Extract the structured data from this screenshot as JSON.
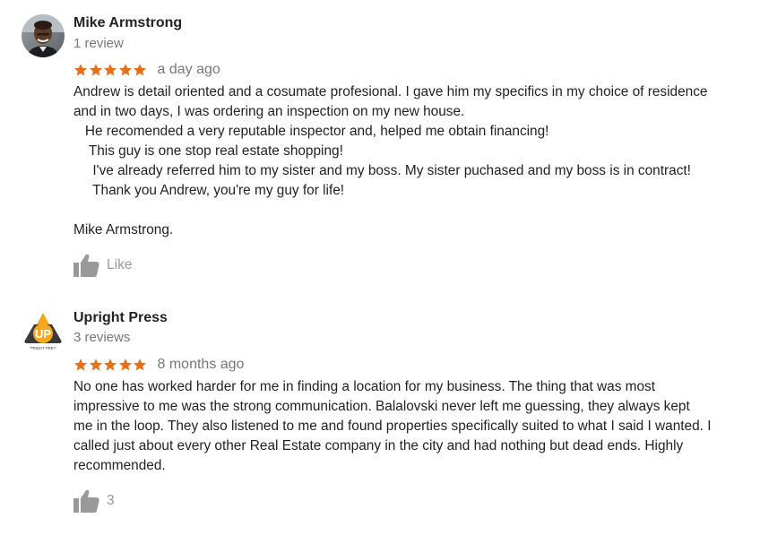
{
  "colors": {
    "star": "#e7711b",
    "name": "#222222",
    "muted": "#777777",
    "like": "#999999",
    "logo_gold": "#f3a91b",
    "logo_dark": "#3a3a3a"
  },
  "reviews": [
    {
      "author": "Mike Armstrong",
      "review_count": "1 review",
      "rating": 5,
      "time_ago": "a day ago",
      "text_lines": [
        "Andrew is detail oriented and a cosumate profesional. I gave him my specifics in my choice of residence",
        "and in two days, I was ordering an inspection on my new house.",
        "   He recomended a very reputable inspector and, helped me obtain financing!",
        "    This guy is one stop real estate shopping!",
        "     I've already referred him to my sister and my boss. My sister puchased and my boss is in contract!",
        "     Thank you Andrew, you're my guy for life!",
        "",
        "Mike Armstrong."
      ],
      "like_label": "Like",
      "avatar_icon": "person-photo-avatar"
    },
    {
      "author": "Upright Press",
      "review_count": "3 reviews",
      "rating": 5,
      "time_ago": "8 months ago",
      "text_lines": [
        "No one has worked harder for me in finding a location for my business. The thing that was most",
        "impressive to me was the strong communication. Balalovski never left me guessing, they always kept",
        "me in the loop. They also listened to me and found properties specifically suited to what I said I wanted. I",
        "called just about every other Real Estate company in the city and had nothing but dead ends. Highly",
        "recommended."
      ],
      "like_label": "3",
      "avatar_icon": "upright-press-logo",
      "logo_letters": "UP",
      "logo_caption": "UPRIGHT PRESS"
    }
  ]
}
